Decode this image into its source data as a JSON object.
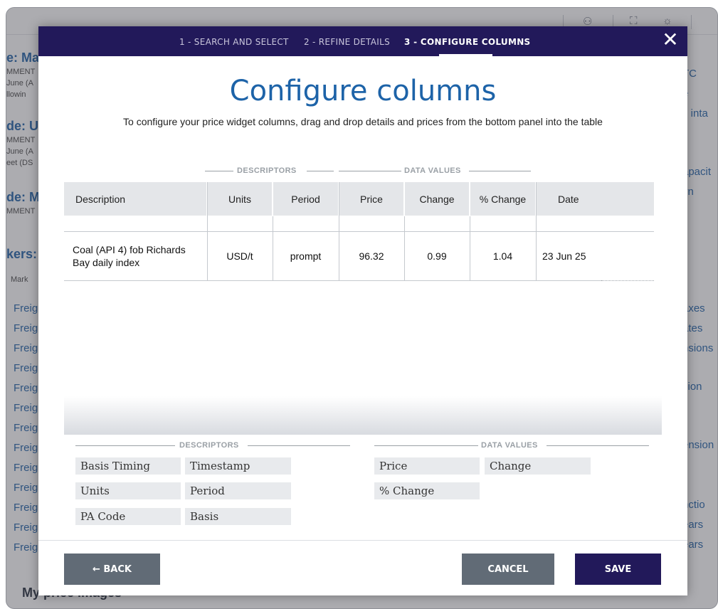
{
  "background": {
    "fragments": [
      "e: Ma",
      "MMENT",
      "June (A",
      "llowin",
      "de: U",
      "MMENT",
      "June (A",
      "eet (DS",
      "de: M",
      "MMENT",
      "kers:",
      "Mark",
      "TC",
      "e",
      "s inta",
      "apacit",
      "vn",
      "axes",
      "ates",
      "nsions",
      "sion",
      "s",
      "ension",
      "nctio",
      "ears",
      "ears",
      "My price images"
    ],
    "links": [
      "Freig",
      "Freig",
      "Freig",
      "Freig",
      "Freig",
      "Freig",
      "Freig",
      "Freig",
      "Freig",
      "Freig",
      "Freig",
      "Freig",
      "Freig"
    ]
  },
  "modal": {
    "steps": [
      "1 - SEARCH AND SELECT",
      "2 - REFINE DETAILS",
      "3 - CONFIGURE COLUMNS"
    ],
    "close_glyph": "✕",
    "title": "Configure columns",
    "subtitle": "To configure your price widget columns, drag and drop details and prices from the bottom panel into the table",
    "table_groups": {
      "descriptors": "DESCRIPTORS",
      "data_values": "DATA VALUES"
    },
    "columns": [
      "Description",
      "Units",
      "Period",
      "Price",
      "Change",
      "% Change",
      "Date"
    ],
    "row": [
      "Coal (API 4) fob Richards Bay daily index",
      "USD/t",
      "prompt",
      "96.32",
      "0.99",
      "1.04",
      "23 Jun 25"
    ],
    "panel": {
      "descriptors_label": "DESCRIPTORS",
      "data_values_label": "DATA VALUES",
      "descriptors": [
        "Basis Timing",
        "Timestamp",
        "Units",
        "Period",
        "PA Code",
        "Basis"
      ],
      "data_values": [
        "Price",
        "Change",
        "% Change"
      ]
    },
    "buttons": {
      "back": "← BACK",
      "cancel": "CANCEL",
      "save": "SAVE"
    }
  }
}
